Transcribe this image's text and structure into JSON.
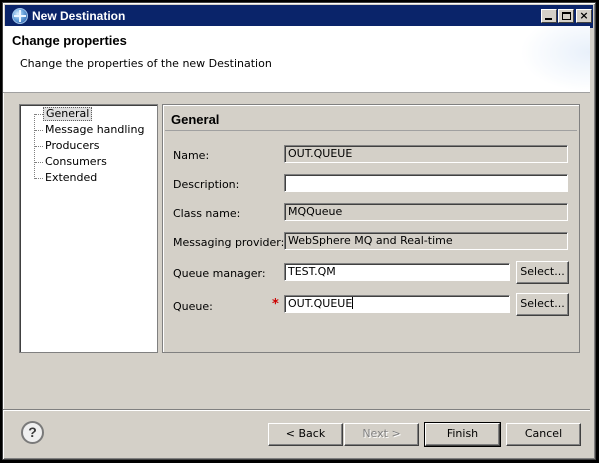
{
  "window": {
    "title": "New Destination",
    "controls": {
      "minimize": "_",
      "maximize": "□",
      "close": "×"
    }
  },
  "header": {
    "title": "Change properties",
    "subtitle": "Change the properties of the new Destination"
  },
  "tree": {
    "items": [
      {
        "label": "General",
        "selected": true
      },
      {
        "label": "Message handling"
      },
      {
        "label": "Producers"
      },
      {
        "label": "Consumers"
      },
      {
        "label": "Extended"
      }
    ]
  },
  "panel": {
    "title": "General",
    "fields": {
      "name": {
        "label": "Name:",
        "value": "OUT.QUEUE"
      },
      "description": {
        "label": "Description:",
        "value": ""
      },
      "class_name": {
        "label": "Class name:",
        "value": "MQQueue"
      },
      "messaging_provider": {
        "label": "Messaging provider:",
        "value": "WebSphere MQ and Real-time"
      },
      "queue_manager": {
        "label": "Queue manager:",
        "value": "TEST.QM",
        "select_label": "Select..."
      },
      "queue": {
        "label": "Queue:",
        "value": "OUT.QUEUE",
        "select_label": "Select...",
        "required_marker": "*"
      }
    }
  },
  "footer": {
    "help_icon": "?",
    "back_label": "< Back",
    "next_label": "Next >",
    "finish_label": "Finish",
    "cancel_label": "Cancel"
  },
  "colors": {
    "titlebar": "#0a246a",
    "dialog_bg": "#d4d0c8",
    "required": "#cc0000"
  }
}
